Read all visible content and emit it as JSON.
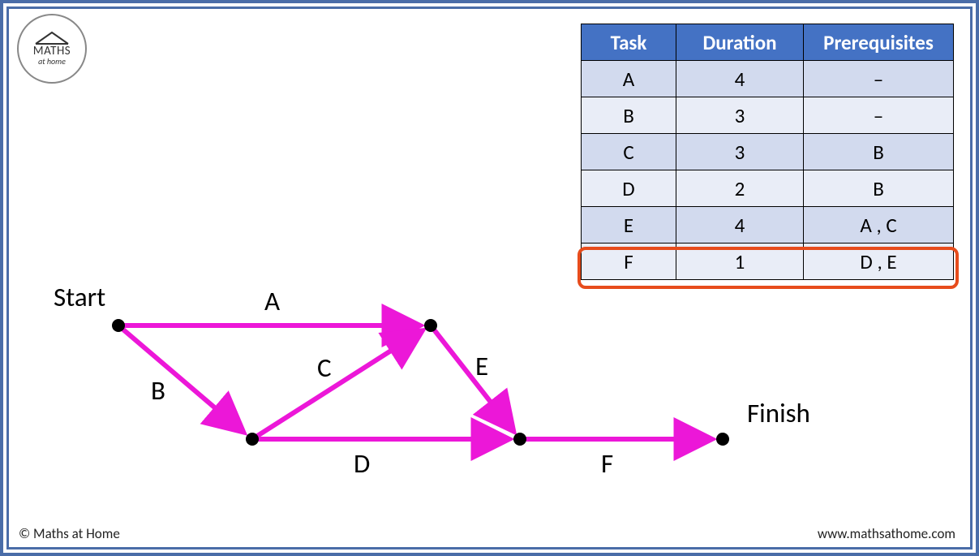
{
  "logo": {
    "line1": "MATHS",
    "line2": "at home"
  },
  "table": {
    "headers": [
      "Task",
      "Duration",
      "Prerequisites"
    ],
    "rows": [
      {
        "task": "A",
        "duration": "4",
        "prereq": "–"
      },
      {
        "task": "B",
        "duration": "3",
        "prereq": "–"
      },
      {
        "task": "C",
        "duration": "3",
        "prereq": "B"
      },
      {
        "task": "D",
        "duration": "2",
        "prereq": "B"
      },
      {
        "task": "E",
        "duration": "4",
        "prereq": "A , C"
      },
      {
        "task": "F",
        "duration": "1",
        "prereq": "D , E"
      }
    ],
    "highlight_row": 5
  },
  "diagram": {
    "start_label": "Start",
    "finish_label": "Finish",
    "edge_labels": {
      "A": "A",
      "B": "B",
      "C": "C",
      "D": "D",
      "E": "E",
      "F": "F"
    }
  },
  "footer": {
    "left": "© Maths at Home",
    "right": "www.mathsathome.com"
  },
  "chart_data": {
    "type": "table",
    "description": "Activity network / precedence diagram",
    "tasks": [
      {
        "name": "A",
        "duration": 4,
        "prerequisites": []
      },
      {
        "name": "B",
        "duration": 3,
        "prerequisites": []
      },
      {
        "name": "C",
        "duration": 3,
        "prerequisites": [
          "B"
        ]
      },
      {
        "name": "D",
        "duration": 2,
        "prerequisites": [
          "B"
        ]
      },
      {
        "name": "E",
        "duration": 4,
        "prerequisites": [
          "A",
          "C"
        ]
      },
      {
        "name": "F",
        "duration": 1,
        "prerequisites": [
          "D",
          "E"
        ]
      }
    ],
    "nodes": [
      "Start",
      "n1",
      "n2",
      "n3",
      "Finish"
    ],
    "edges": [
      {
        "from": "Start",
        "to": "n1",
        "task": "A"
      },
      {
        "from": "Start",
        "to": "n2",
        "task": "B"
      },
      {
        "from": "n2",
        "to": "n1",
        "task": "C"
      },
      {
        "from": "n2",
        "to": "n3",
        "task": "D"
      },
      {
        "from": "n1",
        "to": "n3",
        "task": "E"
      },
      {
        "from": "n3",
        "to": "Finish",
        "task": "F"
      }
    ]
  }
}
